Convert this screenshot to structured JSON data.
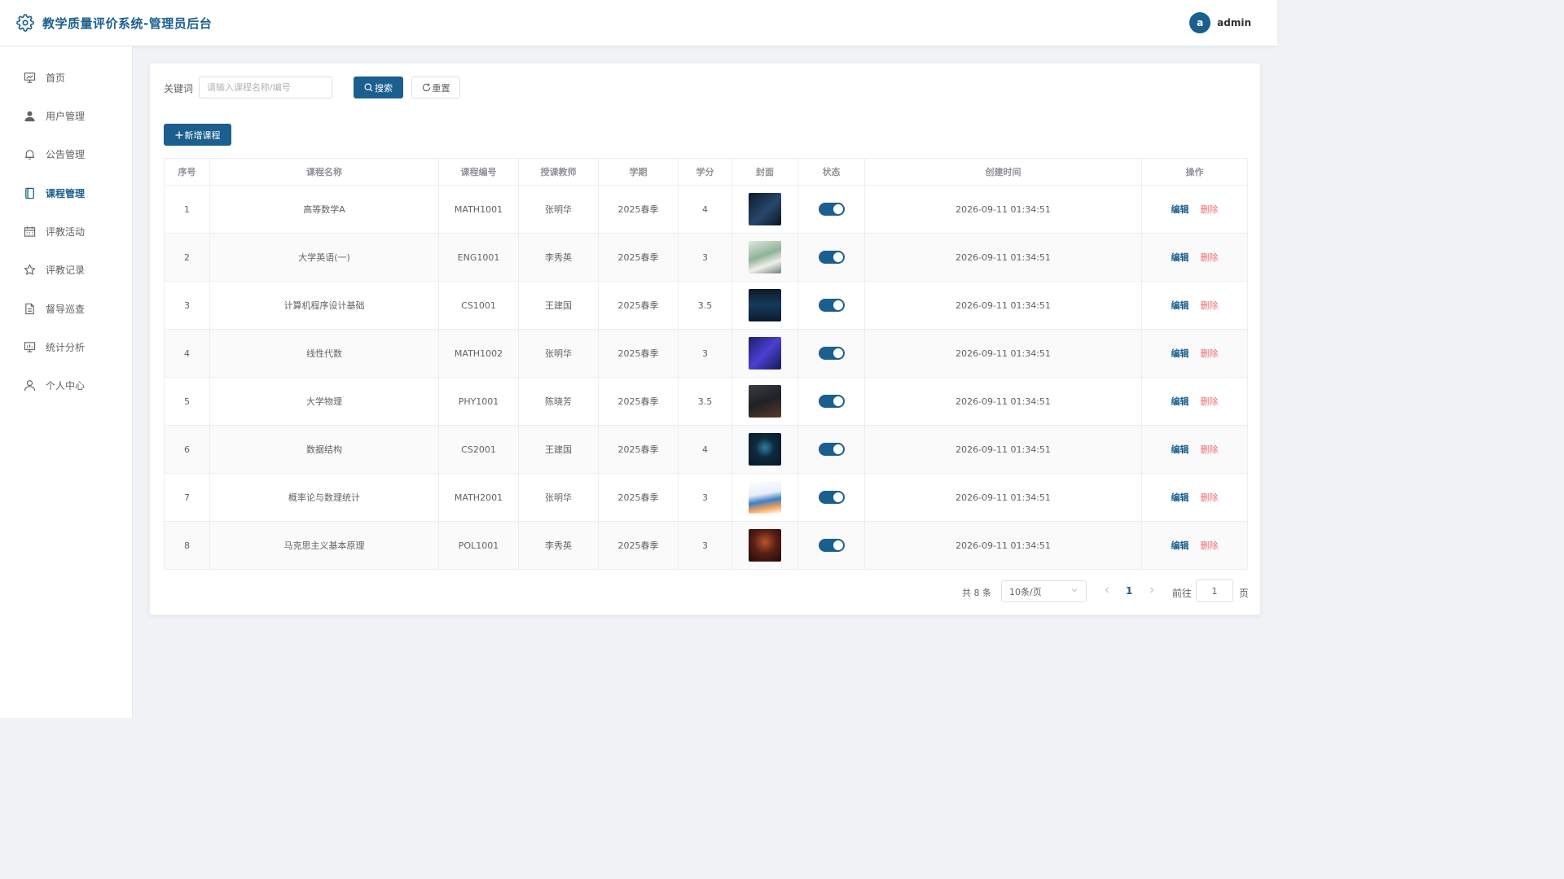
{
  "header": {
    "title": "教学质量评价系统-管理员后台",
    "avatar_letter": "a",
    "username": "admin"
  },
  "sidebar": {
    "items": [
      {
        "label": "首页",
        "icon": "presentation-chart-icon"
      },
      {
        "label": "用户管理",
        "icon": "user-filled-icon"
      },
      {
        "label": "公告管理",
        "icon": "bell-icon"
      },
      {
        "label": "课程管理",
        "icon": "notebook-icon",
        "active": true
      },
      {
        "label": "评教活动",
        "icon": "calendar-icon"
      },
      {
        "label": "评教记录",
        "icon": "star-icon"
      },
      {
        "label": "督导巡查",
        "icon": "document-icon"
      },
      {
        "label": "统计分析",
        "icon": "data-board-icon"
      },
      {
        "label": "个人中心",
        "icon": "user-icon"
      }
    ]
  },
  "search": {
    "label": "关键词",
    "placeholder": "请输入课程名称/编号",
    "search_label": "搜索",
    "reset_label": "重置"
  },
  "add_label": "新增课程",
  "table": {
    "headers": [
      "序号",
      "课程名称",
      "课程编号",
      "授课教师",
      "学期",
      "学分",
      "封面",
      "状态",
      "创建时间",
      "操作"
    ],
    "rows": [
      {
        "no": "1",
        "name": "高等数学A",
        "code": "MATH1001",
        "teacher": "张明华",
        "term": "2025春季",
        "credit": "4",
        "created": "2026-09-11 01:34:51",
        "enabled": true
      },
      {
        "no": "2",
        "name": "大学英语(一)",
        "code": "ENG1001",
        "teacher": "李秀英",
        "term": "2025春季",
        "credit": "3",
        "created": "2026-09-11 01:34:51",
        "enabled": true
      },
      {
        "no": "3",
        "name": "计算机程序设计基础",
        "code": "CS1001",
        "teacher": "王建国",
        "term": "2025春季",
        "credit": "3.5",
        "created": "2026-09-11 01:34:51",
        "enabled": true
      },
      {
        "no": "4",
        "name": "线性代数",
        "code": "MATH1002",
        "teacher": "张明华",
        "term": "2025春季",
        "credit": "3",
        "created": "2026-09-11 01:34:51",
        "enabled": true
      },
      {
        "no": "5",
        "name": "大学物理",
        "code": "PHY1001",
        "teacher": "陈晓芳",
        "term": "2025春季",
        "credit": "3.5",
        "created": "2026-09-11 01:34:51",
        "enabled": true
      },
      {
        "no": "6",
        "name": "数据结构",
        "code": "CS2001",
        "teacher": "王建国",
        "term": "2025春季",
        "credit": "4",
        "created": "2026-09-11 01:34:51",
        "enabled": true
      },
      {
        "no": "7",
        "name": "概率论与数理统计",
        "code": "MATH2001",
        "teacher": "张明华",
        "term": "2025春季",
        "credit": "3",
        "created": "2026-09-11 01:34:51",
        "enabled": true
      },
      {
        "no": "8",
        "name": "马克思主义基本原理",
        "code": "POL1001",
        "teacher": "李秀英",
        "term": "2025春季",
        "credit": "3",
        "created": "2026-09-11 01:34:51",
        "enabled": true
      }
    ],
    "edit_label": "编辑",
    "delete_label": "删除"
  },
  "pagination": {
    "total_text": "共 8 条",
    "page_size": "10条/页",
    "current_page": "1",
    "goto_prefix": "前往",
    "goto_value": "1",
    "goto_suffix": "页"
  },
  "colors": {
    "primary": "#1a5f8e",
    "danger": "#f56c6c"
  }
}
